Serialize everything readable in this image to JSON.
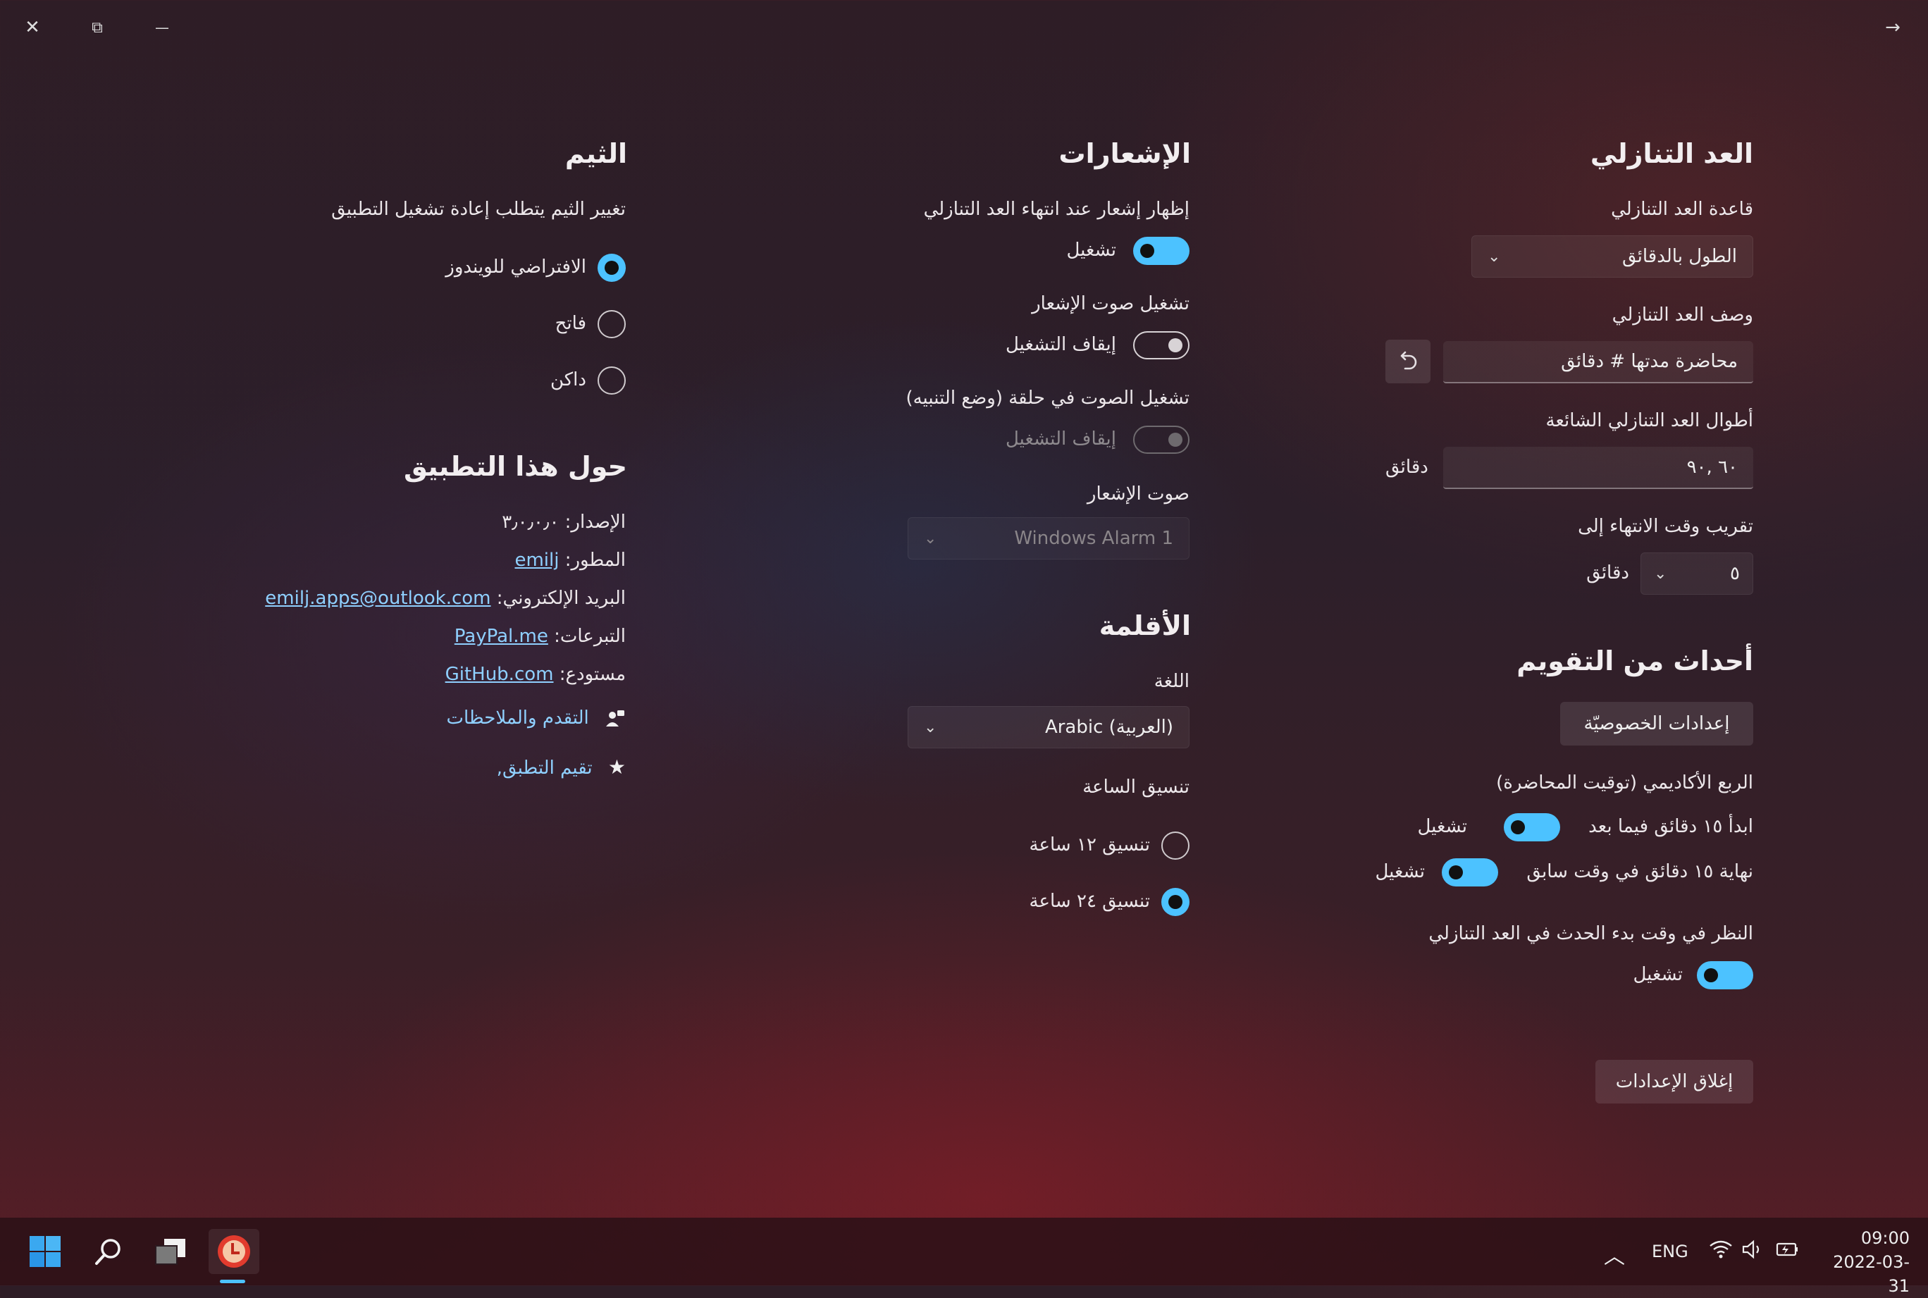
{
  "window": {
    "close_glyph": "✕",
    "restore_glyph": "⧉",
    "minimize_glyph": "—",
    "back_glyph": "→"
  },
  "countdown": {
    "heading": "العد التنازلي",
    "basis_label": "قاعدة العد التنازلي",
    "basis_value": "الطول بالدقائق",
    "description_label": "وصف العد التنازلي",
    "description_value": "محاضرة مدتها # دقائق",
    "common_lengths_label": "أطوال العد التنازلي الشائعة",
    "common_lengths_value": "٦٠ ,٩٠",
    "common_lengths_unit": "دقائق",
    "round_label": "تقريب وقت الانتهاء إلى",
    "round_value": "٥",
    "round_unit": "دقائق"
  },
  "calendar": {
    "heading": "أحداث من التقويم",
    "privacy_button": "إعدادات الخصوصيّة",
    "academic_label": "الربع الأكاديمي (توقيت المحاضرة)",
    "start_later_label": "ابدأ ١٥ دقائق فيما بعد",
    "start_later_state": "تشغيل",
    "end_earlier_label": "نهاية ١٥ دقائق في وقت سابق",
    "end_earlier_state": "تشغيل",
    "consider_start_label": "النظر في وقت بدء الحدث في العد التنازلي",
    "consider_start_state": "تشغيل"
  },
  "close_settings_button": "إغلاق الإعدادات",
  "notifications": {
    "heading": "الإشعارات",
    "show_label": "إظهار إشعار عند انتهاء العد التنازلي",
    "show_state": "تشغيل",
    "sound_label": "تشغيل صوت الإشعار",
    "sound_state": "إيقاف التشغيل",
    "loop_label": "تشغيل الصوت في حلقة (وضع التنبيه)",
    "loop_state": "إيقاف التشغيل",
    "tone_label": "صوت الإشعار",
    "tone_value": "Windows Alarm 1"
  },
  "localization": {
    "heading": "الأقلمة",
    "language_label": "اللغة",
    "language_value": "Arabic (العربية)",
    "time_format_label": "تنسيق الساعة",
    "format_12": "تنسيق ١٢ ساعة",
    "format_24": "تنسيق ٢٤ ساعة",
    "selected_format": "24"
  },
  "theme": {
    "heading": "الثيم",
    "note": "تغيير الثيم يتطلب إعادة تشغيل التطبيق",
    "options": [
      "الافتراضي للويندوز",
      "فاتح",
      "داكن"
    ],
    "selected": "الافتراضي للويندوز"
  },
  "about": {
    "heading": "حول هذا التطبيق",
    "version_label": "الإصدار:",
    "version_value": "٣٫٠٫٠٫٠",
    "developer_label": "المطور:",
    "developer_value": "emilj",
    "email_label": "البريد الإلكتروني:",
    "email_value": "emilj.apps@outlook.com",
    "donations_label": "التبرعات:",
    "donations_value": "PayPal.me",
    "repo_label": "مستودع:",
    "repo_value": "GitHub.com",
    "feedback_link": "التقدم والملاحظات",
    "rate_link": "تقيم التطبق,"
  },
  "taskbar": {
    "language": "ENG",
    "time": "09:00",
    "date": "2022-03-31"
  },
  "colors": {
    "accent": "#4cc2ff",
    "link": "#8fd0ff"
  }
}
